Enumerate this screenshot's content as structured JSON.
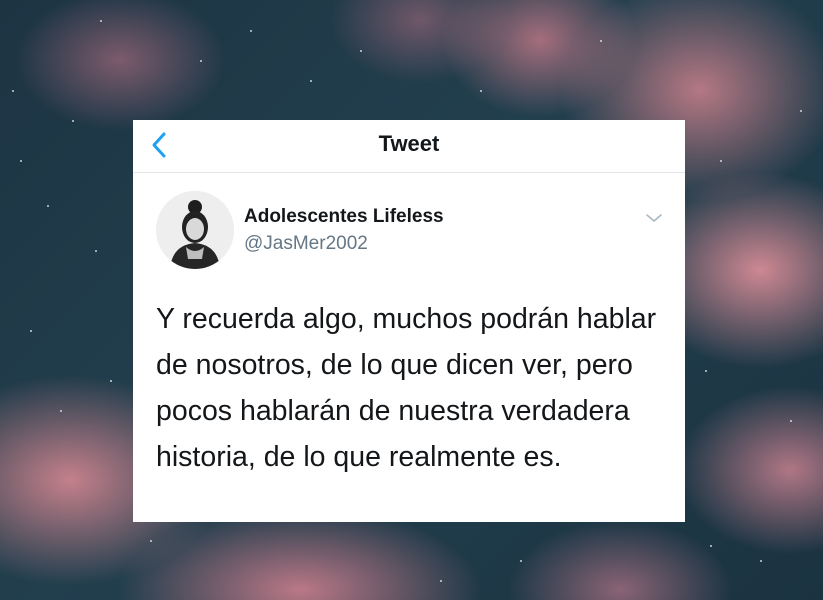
{
  "header": {
    "title": "Tweet",
    "back_icon": "chevron-left-icon",
    "accent_color": "#1da1f2"
  },
  "tweet": {
    "display_name": "Adolescentes Lifeless",
    "handle": "@JasMer2002",
    "text": "Y recuerda algo, muchos podrán hablar de nosotros, de lo que dicen ver, pero pocos hablarán de nuestra verdadera historia, de lo que realmente es.",
    "more_icon": "chevron-down-icon"
  },
  "background": {
    "description_icon": "night-sky-clouds-background",
    "cloud_color": "#e58c98",
    "sky_color": "#1f3a48"
  }
}
